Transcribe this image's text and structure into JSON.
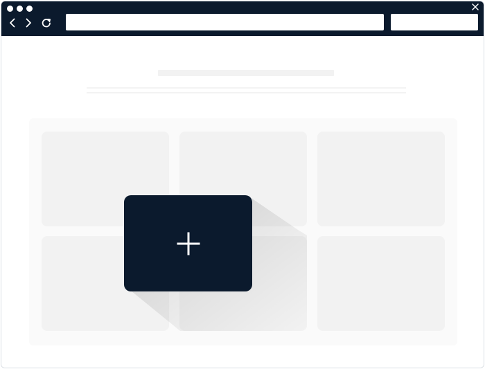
{
  "browser": {
    "address_value": "",
    "secondary_value": ""
  },
  "icons": {
    "back": "chevron-left",
    "forward": "chevron-right",
    "reload": "reload",
    "close": "close",
    "add": "plus"
  },
  "colors": {
    "chrome": "#0b1a2d",
    "card_fill": "#f2f2f2",
    "panel_fill": "#fafafa"
  }
}
